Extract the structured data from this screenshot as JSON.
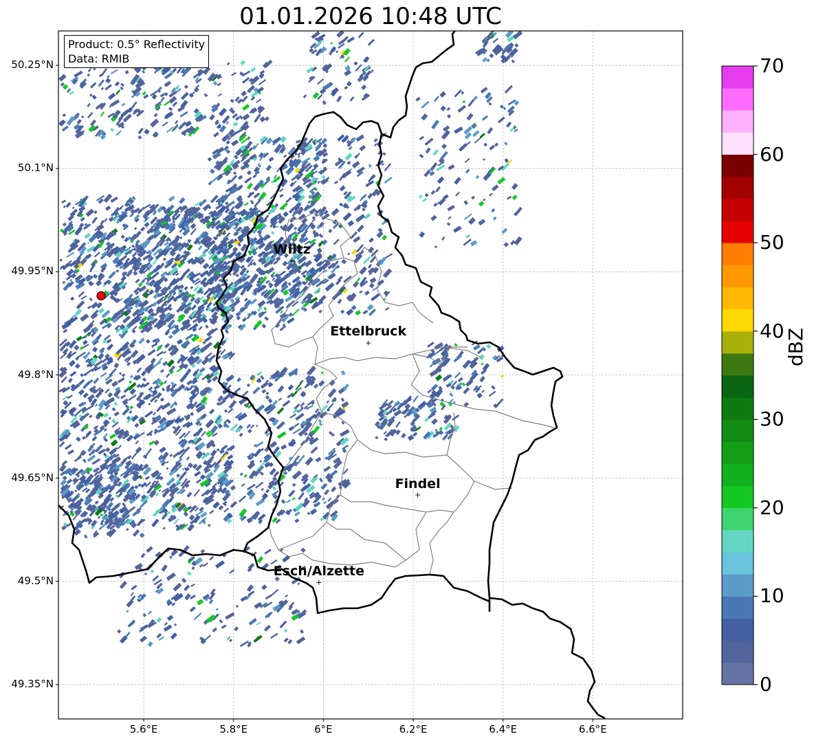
{
  "title": "01.01.2026 10:48 UTC",
  "info": {
    "product": "Product: 0.5° Reflectivity",
    "data_source": "Data: RMIB"
  },
  "map": {
    "projection": "lat-lon",
    "lon_range": [
      5.41,
      6.8
    ],
    "lat_range": [
      49.3,
      50.3
    ],
    "gridlines": true,
    "lat_ticks": [
      {
        "value": 50.25,
        "label": "50.25°N"
      },
      {
        "value": 50.1,
        "label": "50.1°N"
      },
      {
        "value": 49.95,
        "label": "49.95°N"
      },
      {
        "value": 49.8,
        "label": "49.8°N"
      },
      {
        "value": 49.65,
        "label": "49.65°N"
      },
      {
        "value": 49.5,
        "label": "49.5°N"
      },
      {
        "value": 49.35,
        "label": "49.35°N"
      }
    ],
    "lon_ticks": [
      {
        "value": 5.6,
        "label": "5.6°E"
      },
      {
        "value": 5.8,
        "label": "5.8°E"
      },
      {
        "value": 6.0,
        "label": "6°E"
      },
      {
        "value": 6.2,
        "label": "6.2°E"
      },
      {
        "value": 6.4,
        "label": "6.4°E"
      },
      {
        "value": 6.6,
        "label": "6.6°E"
      }
    ],
    "radar_site": {
      "lon": 5.505,
      "lat": 49.915,
      "color": "#ff0000"
    },
    "cities": [
      {
        "name": "Wiltz",
        "lon": 5.93,
        "lat": 49.966
      },
      {
        "name": "Ettelbruck",
        "lon": 6.1,
        "lat": 49.847
      },
      {
        "name": "Findel",
        "lon": 6.21,
        "lat": 49.626
      },
      {
        "name": "Esch/Alzette",
        "lon": 5.99,
        "lat": 49.499
      }
    ],
    "border_color": "#000000",
    "district_color": "#808080"
  },
  "colorbar": {
    "label": "dBZ",
    "min": 0,
    "max": 70,
    "step": 2.5,
    "tick_labels": [
      "0",
      "10",
      "20",
      "30",
      "40",
      "50",
      "60",
      "70"
    ],
    "colors": [
      "#6473a4",
      "#52649b",
      "#4460a3",
      "#4a78b3",
      "#5b9bc8",
      "#69c3dd",
      "#62d6c3",
      "#3fd470",
      "#14c824",
      "#12b11e",
      "#139e16",
      "#138c14",
      "#0d7a12",
      "#0a6510",
      "#3e7810",
      "#aab00a",
      "#ffd800",
      "#ffb800",
      "#ff9800",
      "#ff7e00",
      "#e60000",
      "#c40000",
      "#a40000",
      "#7a0000",
      "#ffe1ff",
      "#ffb0ff",
      "#ff6cff",
      "#e63ced"
    ]
  }
}
